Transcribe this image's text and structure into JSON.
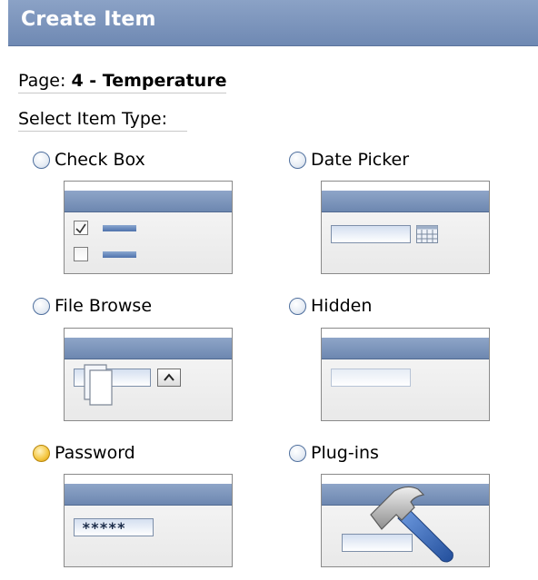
{
  "header": {
    "title": "Create Item"
  },
  "page": {
    "label": "Page:",
    "value": "4 - Temperature"
  },
  "select_type_label": "Select Item Type:",
  "item_types": [
    {
      "label": "Check Box",
      "selected": false,
      "icon": "checkbox-preview-icon"
    },
    {
      "label": "Date Picker",
      "selected": false,
      "icon": "date-picker-preview-icon"
    },
    {
      "label": "File Browse",
      "selected": false,
      "icon": "file-browse-preview-icon"
    },
    {
      "label": "Hidden",
      "selected": false,
      "icon": "hidden-preview-icon"
    },
    {
      "label": "Password",
      "selected": true,
      "icon": "password-preview-icon"
    },
    {
      "label": "Plug-ins",
      "selected": false,
      "icon": "plugins-preview-icon"
    }
  ],
  "password_mask": "*****",
  "colors": {
    "header_bg": "#7f97bf",
    "radio_selected": "#f4c640",
    "preview_bar": "#6d87b0"
  }
}
